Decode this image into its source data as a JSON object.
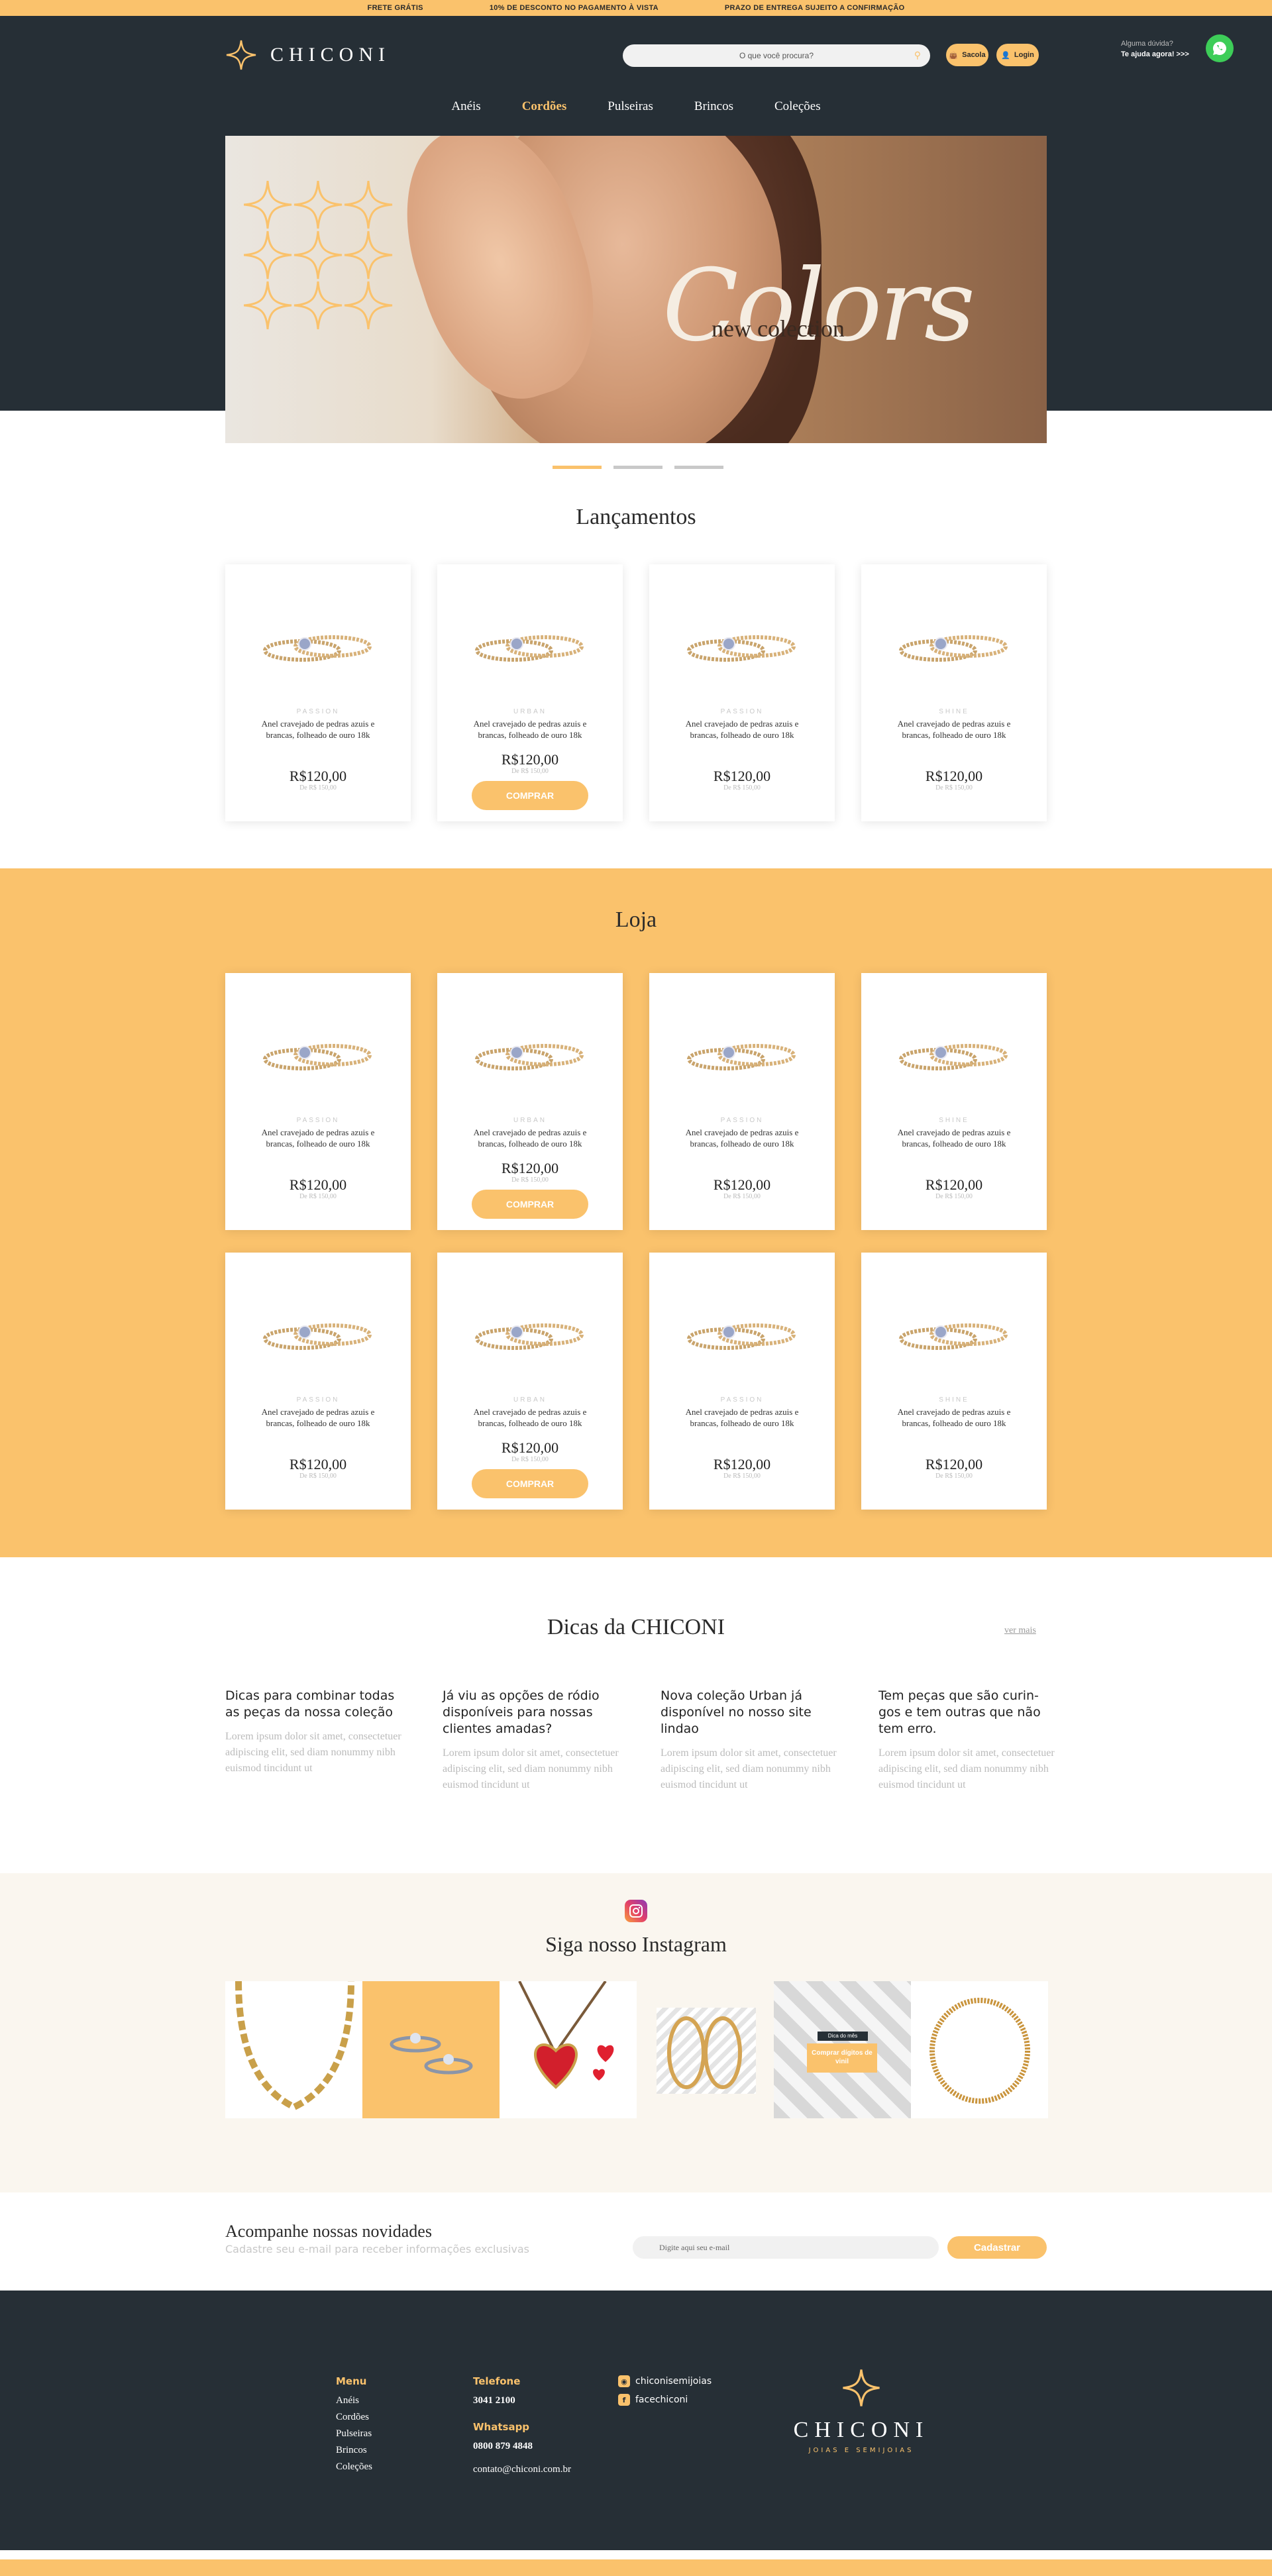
{
  "topbar": [
    "FRETE GRÁTIS",
    "10% DE DESCONTO NO PAGAMENTO À VISTA",
    "PRAZO DE ENTREGA SUJEITO A CONFIRMAÇÃO"
  ],
  "brand": {
    "name": "CHICONI",
    "tagline": "JOIAS E SEMIJOIAS"
  },
  "search": {
    "placeholder": "O que você procura?"
  },
  "header": {
    "bag_label": "Sacola",
    "login_label": "Login",
    "help_question": "Alguma dúvida?",
    "help_cta": "Te ajuda agora! >>>"
  },
  "nav": [
    {
      "label": "Anéis",
      "active": false
    },
    {
      "label": "Cordões",
      "active": true
    },
    {
      "label": "Pulseiras",
      "active": false
    },
    {
      "label": "Brincos",
      "active": false
    },
    {
      "label": "Coleções",
      "active": false
    }
  ],
  "hero": {
    "subtitle": "new colection",
    "title": "Colors",
    "slides": 3,
    "active_slide": 1
  },
  "launches": {
    "title": "Lançamentos",
    "products": [
      {
        "brand": "PASSION",
        "name": "Anel cravejado de pedras azuis e brancas, folheado de ouro 18k",
        "price": "R$120,00",
        "old_price": "De R$ 150,00",
        "buy": ""
      },
      {
        "brand": "URBAN",
        "name": "Anel cravejado de pedras azuis e brancas, folheado de ouro 18k",
        "price": "R$120,00",
        "old_price": "De R$ 150,00",
        "buy": "COMPRAR"
      },
      {
        "brand": "PASSION",
        "name": "Anel cravejado de pedras azuis e brancas, folheado de ouro 18k",
        "price": "R$120,00",
        "old_price": "De R$ 150,00",
        "buy": ""
      },
      {
        "brand": "SHINE",
        "name": "Anel cravejado de pedras azuis e brancas, folheado de ouro 18k",
        "price": "R$120,00",
        "old_price": "De R$ 150,00",
        "buy": ""
      }
    ]
  },
  "shop": {
    "title": "Loja",
    "products": [
      {
        "brand": "PASSION",
        "name": "Anel cravejado de pedras azuis e brancas, folheado de ouro 18k",
        "price": "R$120,00",
        "old_price": "De R$ 150,00",
        "buy": ""
      },
      {
        "brand": "URBAN",
        "name": "Anel cravejado de pedras azuis e brancas, folheado de ouro 18k",
        "price": "R$120,00",
        "old_price": "De R$ 150,00",
        "buy": "COMPRAR"
      },
      {
        "brand": "PASSION",
        "name": "Anel cravejado de pedras azuis e brancas, folheado de ouro 18k",
        "price": "R$120,00",
        "old_price": "De R$ 150,00",
        "buy": ""
      },
      {
        "brand": "SHINE",
        "name": "Anel cravejado de pedras azuis e brancas, folheado de ouro 18k",
        "price": "R$120,00",
        "old_price": "De R$ 150,00",
        "buy": ""
      },
      {
        "brand": "PASSION",
        "name": "Anel cravejado de pedras azuis e brancas, folheado de ouro 18k",
        "price": "R$120,00",
        "old_price": "De R$ 150,00",
        "buy": ""
      },
      {
        "brand": "URBAN",
        "name": "Anel cravejado de pedras azuis e brancas, folheado de ouro 18k",
        "price": "R$120,00",
        "old_price": "De R$ 150,00",
        "buy": "COMPRAR"
      },
      {
        "brand": "PASSION",
        "name": "Anel cravejado de pedras azuis e brancas, folheado de ouro 18k",
        "price": "R$120,00",
        "old_price": "De R$ 150,00",
        "buy": ""
      },
      {
        "brand": "SHINE",
        "name": "Anel cravejado de pedras azuis e brancas, folheado de ouro 18k",
        "price": "R$120,00",
        "old_price": "De R$ 150,00",
        "buy": ""
      }
    ]
  },
  "tips": {
    "title": "Dicas da CHICONI",
    "more": "ver mais",
    "posts": [
      {
        "title": "Dicas para combinar todas as peças da nossa coleção",
        "excerpt": "Lorem ipsum dolor sit amet, consectetuer adipiscing elit, sed diam nonummy nibh euismod tincidunt ut"
      },
      {
        "title": "Já viu as opções de ródio disponíveis para nossas clientes amadas?",
        "excerpt": "Lorem ipsum dolor sit amet, consectetuer adipiscing elit, sed diam nonummy nibh euismod tincidunt ut"
      },
      {
        "title": "Nova coleção Urban já disponível no nosso site lindao",
        "excerpt": "Lorem ipsum dolor sit amet, consectetuer adipiscing elit, sed diam nonummy nibh euismod tincidunt ut"
      },
      {
        "title": "Tem peças que são curin-gos e tem outras que não tem erro.",
        "excerpt": "Lorem ipsum dolor sit amet, consectetuer adipiscing elit, sed diam nonummy nibh euismod tincidunt ut"
      }
    ]
  },
  "instagram": {
    "title": "Siga nosso Instagram",
    "tile_small": "Dica do mês",
    "tile_big": "Comprar dígitos de vinil"
  },
  "newsletter": {
    "title": "Acompanhe nossas novidades",
    "subtitle": "Cadastre seu e-mail para receber informações exclusivas",
    "placeholder": "Digite aqui seu e-mail",
    "button": "Cadastrar"
  },
  "footer": {
    "menu_title": "Menu",
    "menu": [
      "Anéis",
      "Cordões",
      "Pulseiras",
      "Brincos",
      "Coleções"
    ],
    "phone_title": "Telefone",
    "phone": "3041 2100",
    "whatsapp_title": "Whatsapp",
    "whatsapp": "0800 879 4848",
    "email": "contato@chiconi.com.br",
    "instagram": "chiconisemijoias",
    "facebook": "facechiconi"
  },
  "colors": {
    "accent": "#fac26c",
    "dark": "#262f36",
    "cream": "#faf6ef",
    "whatsapp": "#3dcd58"
  }
}
